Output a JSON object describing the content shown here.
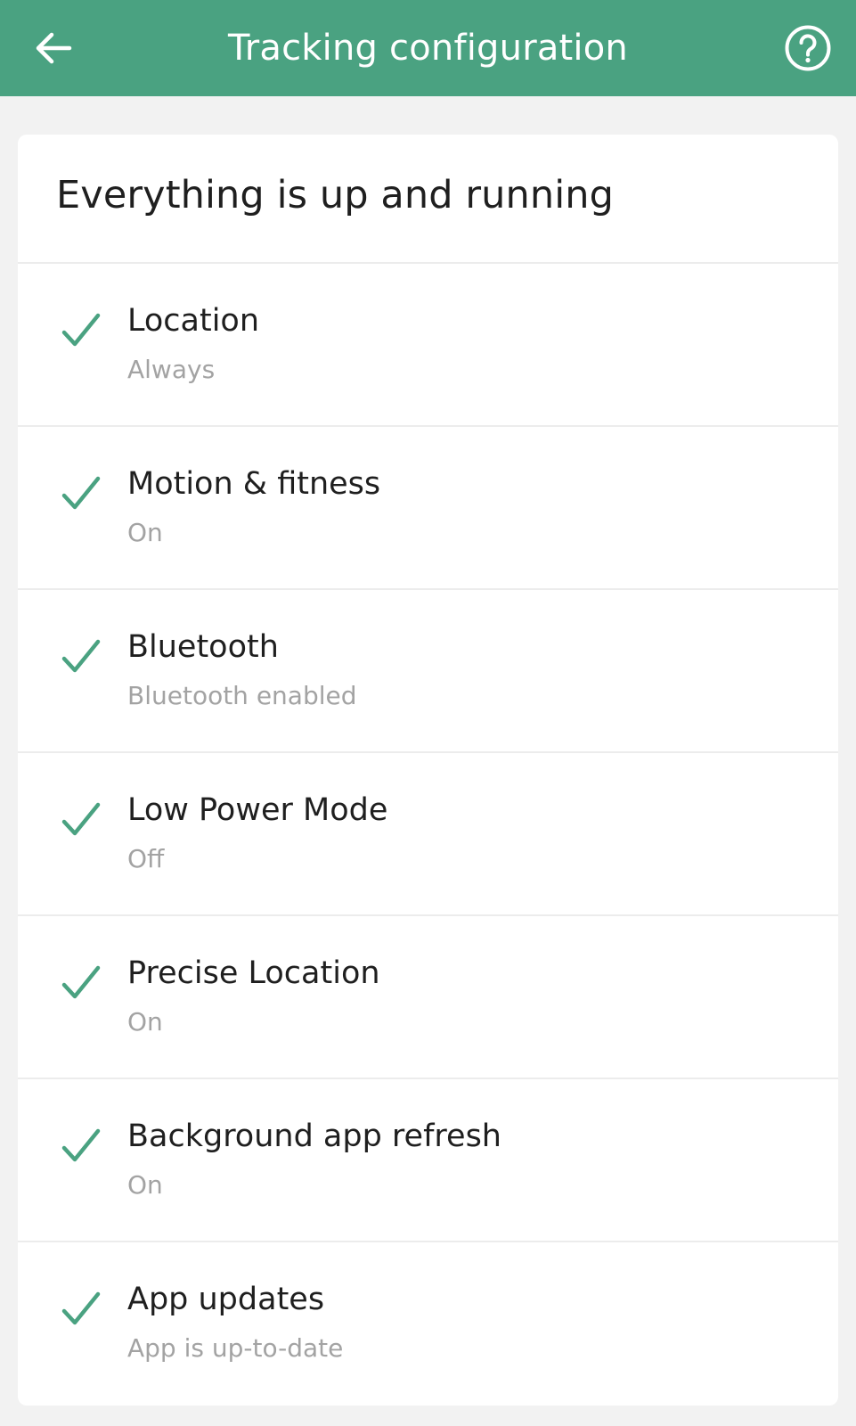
{
  "app_bar": {
    "title": "Tracking configuration",
    "back_icon": "arrow-left-icon",
    "help_icon": "question-circle-icon",
    "background_color": "#4aa281"
  },
  "status": {
    "heading": "Everything is up and running"
  },
  "items": [
    {
      "label": "Location",
      "value": "Always",
      "icon": "checkmark-icon"
    },
    {
      "label": "Motion & fitness",
      "value": "On",
      "icon": "checkmark-icon"
    },
    {
      "label": "Bluetooth",
      "value": "Bluetooth enabled",
      "icon": "checkmark-icon"
    },
    {
      "label": "Low Power Mode",
      "value": "Off",
      "icon": "checkmark-icon"
    },
    {
      "label": "Precise Location",
      "value": "On",
      "icon": "checkmark-icon"
    },
    {
      "label": "Background app refresh",
      "value": "On",
      "icon": "checkmark-icon"
    },
    {
      "label": "App updates",
      "value": "App is up-to-date",
      "icon": "checkmark-icon"
    }
  ],
  "colors": {
    "accent": "#4aa281",
    "check": "#4aa281",
    "secondary_text": "#a3a3a3"
  }
}
